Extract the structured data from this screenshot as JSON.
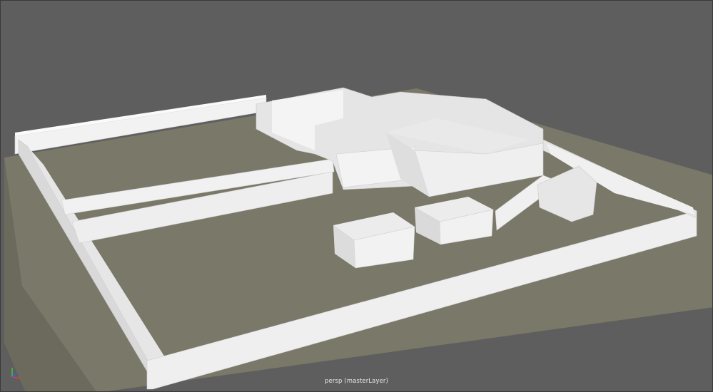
{
  "viewport": {
    "camera_label": "persp (masterLayer)",
    "background_color": "#5e5e5e",
    "ground_color": "#7a7868",
    "wall_color": "#efefef"
  },
  "scene": {
    "objects": [
      "ground-plane",
      "perimeter-wall-front",
      "perimeter-wall-left",
      "perimeter-wall-back",
      "perimeter-wall-right",
      "interior-long-wall-upper",
      "interior-long-wall-lower",
      "building-complex-rooms",
      "large-box-building",
      "small-box-left",
      "small-box-middle",
      "ramp",
      "block-right"
    ]
  },
  "axis_gizmo": {
    "icon": "axis-gizmo-icon",
    "x_color": "#d94040",
    "y_color": "#40c040",
    "z_color": "#4060e0"
  }
}
